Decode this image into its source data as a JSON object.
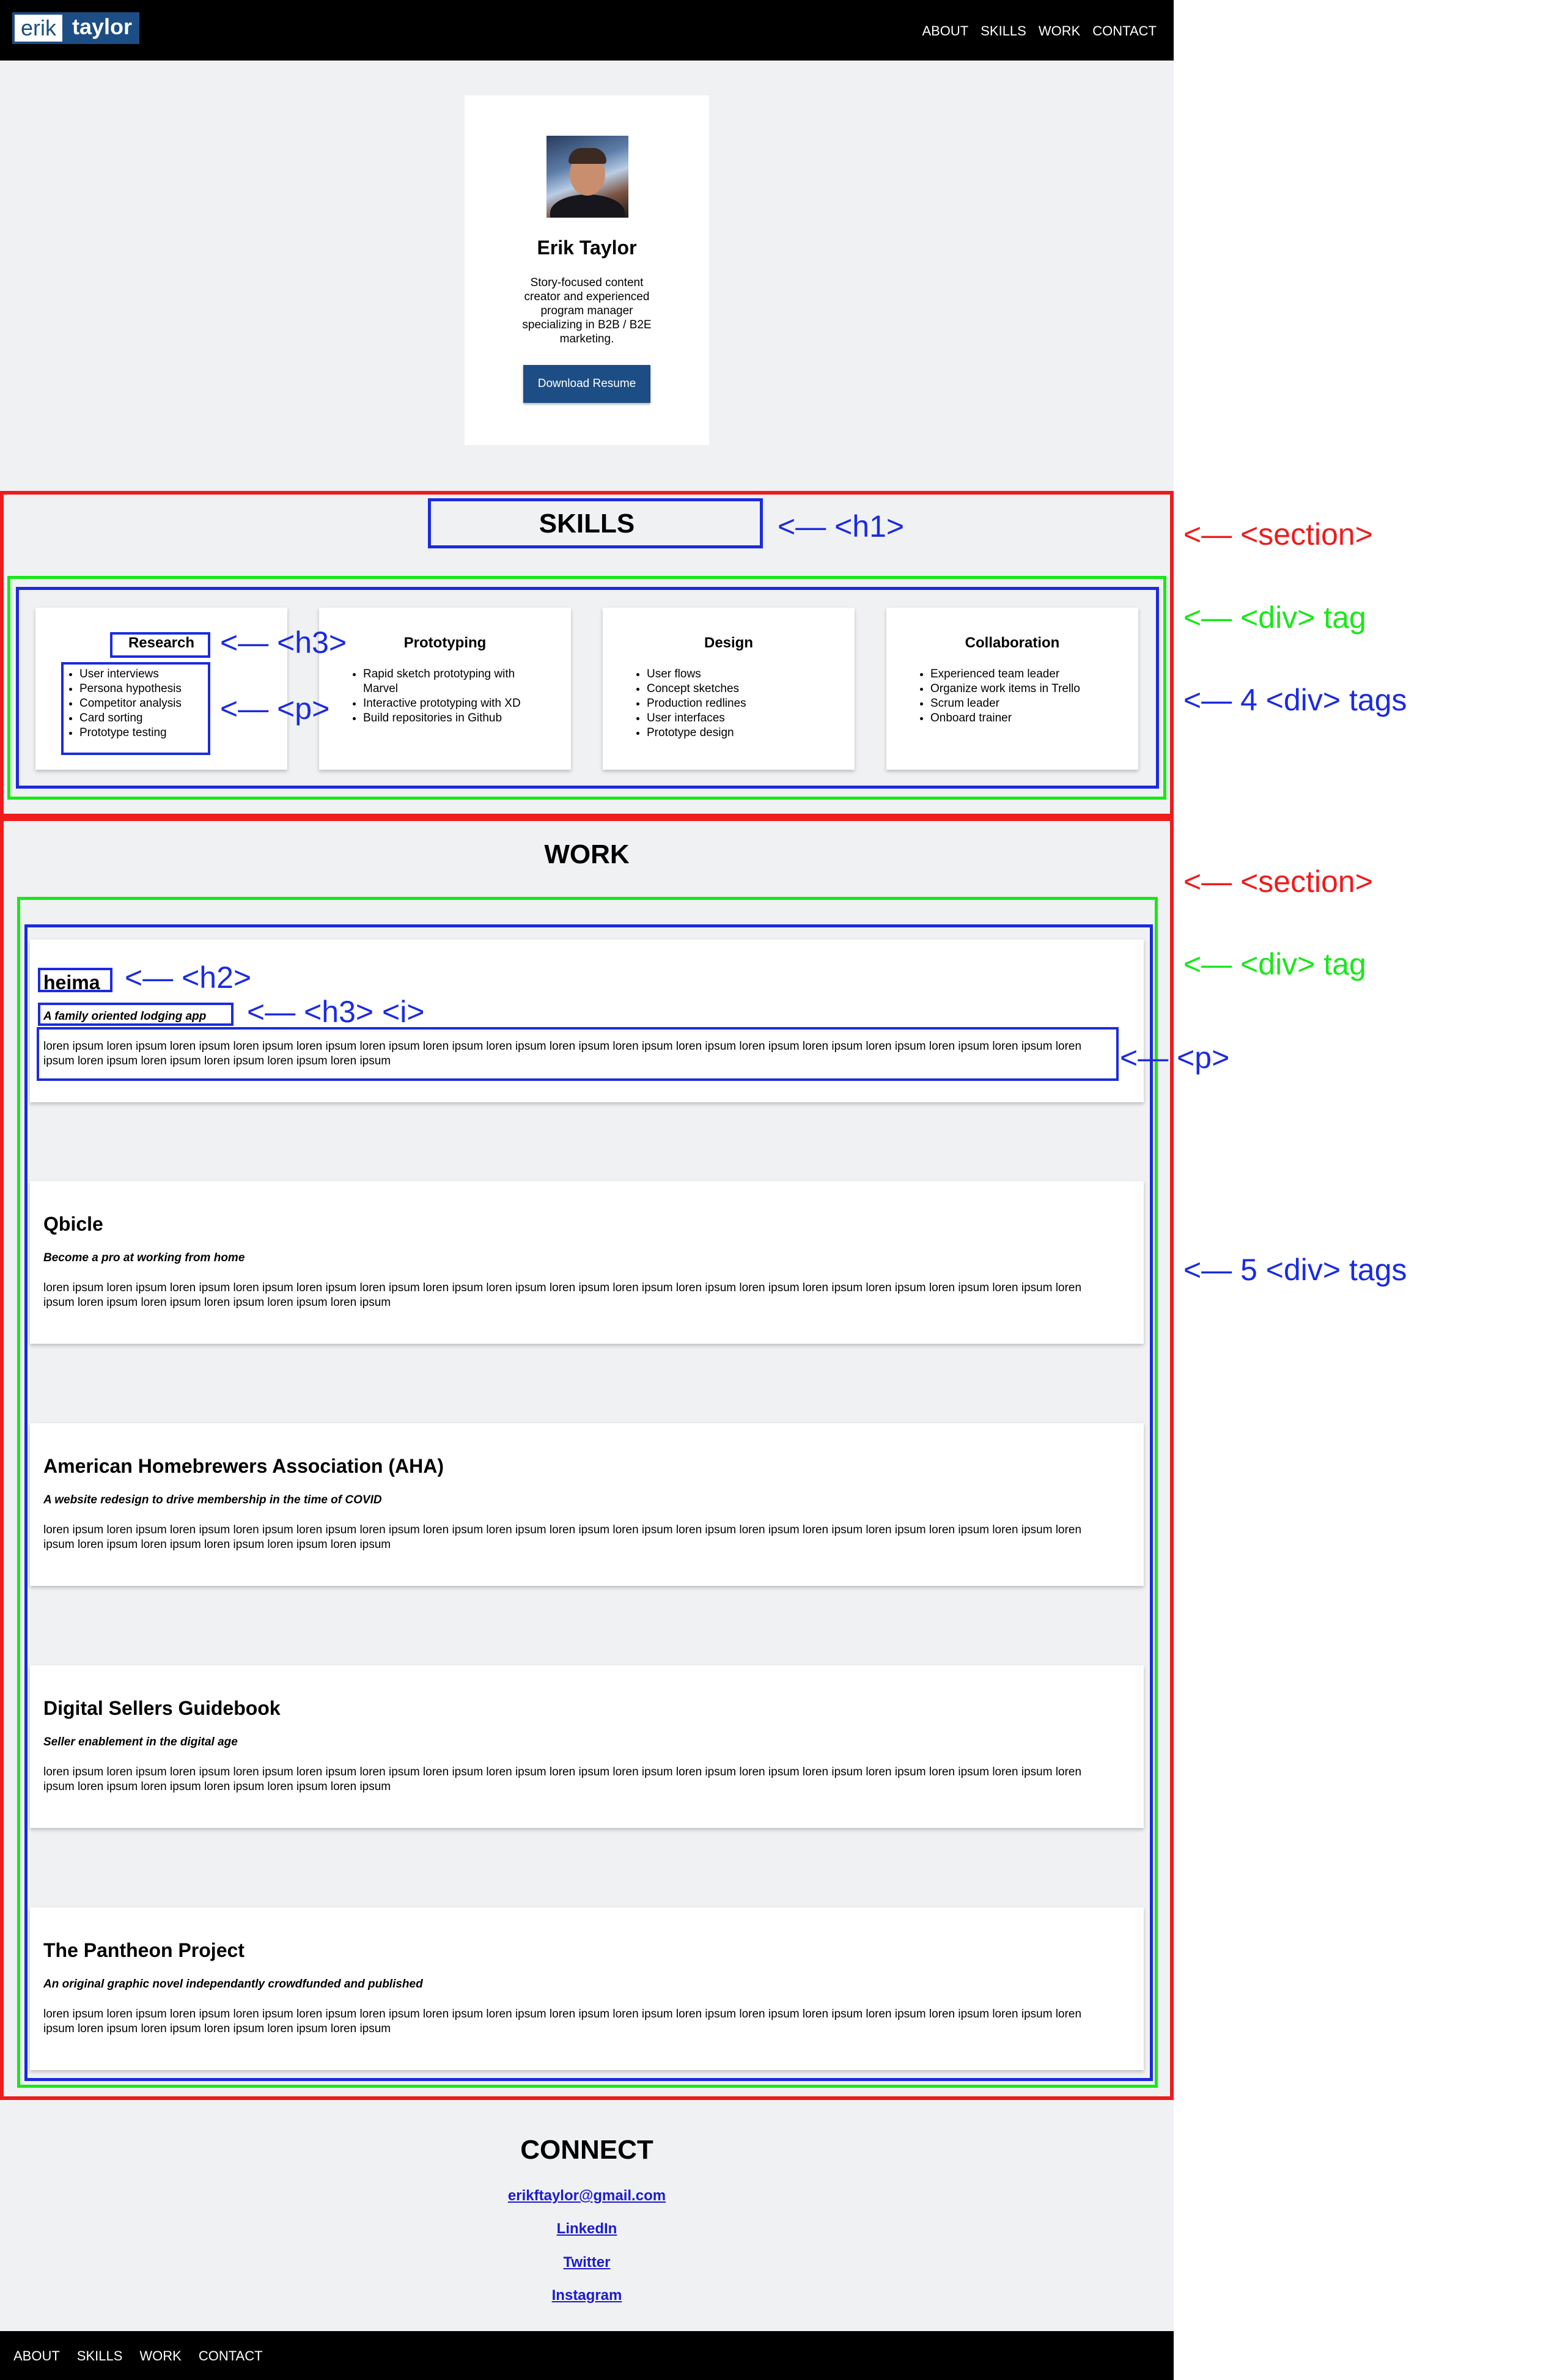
{
  "header": {
    "logo_first": "erik",
    "logo_last": "taylor",
    "nav": [
      "ABOUT",
      "SKILLS",
      "WORK",
      "CONTACT"
    ]
  },
  "profile": {
    "name": "Erik Taylor",
    "bio": "Story-focused content creator and experienced program manager specializing in B2B / B2E marketing.",
    "button": "Download Resume"
  },
  "skills": {
    "title": "SKILLS",
    "cards": [
      {
        "title": "Research",
        "items": [
          "User interviews",
          "Persona hypothesis",
          "Competitor analysis",
          "Card sorting",
          "Prototype testing"
        ]
      },
      {
        "title": "Prototyping",
        "items": [
          "Rapid sketch prototyping with Marvel",
          "Interactive prototyping with XD",
          "Build repositories in Github"
        ]
      },
      {
        "title": "Design",
        "items": [
          "User flows",
          "Concept sketches",
          "Production redlines",
          "User interfaces",
          "Prototype design"
        ]
      },
      {
        "title": "Collaboration",
        "items": [
          "Experienced team leader",
          "Organize work items in Trello",
          "Scrum leader",
          "Onboard trainer"
        ]
      }
    ]
  },
  "work": {
    "title": "WORK",
    "projects": [
      {
        "title": "heima",
        "subtitle": "A family oriented lodging app",
        "body": "loren ipsum loren ipsum loren ipsum loren ipsum loren ipsum loren ipsum loren ipsum loren ipsum loren ipsum loren ipsum loren ipsum loren ipsum loren ipsum loren ipsum loren ipsum loren ipsum loren ipsum loren ipsum loren ipsum loren ipsum loren ipsum loren ipsum"
      },
      {
        "title": "Qbicle",
        "subtitle": "Become a pro at working from home",
        "body": "loren ipsum loren ipsum loren ipsum loren ipsum loren ipsum loren ipsum loren ipsum loren ipsum loren ipsum loren ipsum loren ipsum loren ipsum loren ipsum loren ipsum loren ipsum loren ipsum loren ipsum loren ipsum loren ipsum loren ipsum loren ipsum loren ipsum"
      },
      {
        "title": "American Homebrewers Association (AHA)",
        "subtitle": "A website redesign to drive membership in the time of COVID",
        "body": "loren ipsum loren ipsum loren ipsum loren ipsum loren ipsum loren ipsum loren ipsum loren ipsum loren ipsum loren ipsum loren ipsum loren ipsum loren ipsum loren ipsum loren ipsum loren ipsum loren ipsum loren ipsum loren ipsum loren ipsum loren ipsum loren ipsum"
      },
      {
        "title": "Digital Sellers Guidebook",
        "subtitle": "Seller enablement in the digital age",
        "body": "loren ipsum loren ipsum loren ipsum loren ipsum loren ipsum loren ipsum loren ipsum loren ipsum loren ipsum loren ipsum loren ipsum loren ipsum loren ipsum loren ipsum loren ipsum loren ipsum loren ipsum loren ipsum loren ipsum loren ipsum loren ipsum loren ipsum"
      },
      {
        "title": "The Pantheon Project",
        "subtitle": "An original graphic novel independantly crowdfunded and published",
        "body": "loren ipsum loren ipsum loren ipsum loren ipsum loren ipsum loren ipsum loren ipsum loren ipsum loren ipsum loren ipsum loren ipsum loren ipsum loren ipsum loren ipsum loren ipsum loren ipsum loren ipsum loren ipsum loren ipsum loren ipsum loren ipsum loren ipsum"
      }
    ]
  },
  "connect": {
    "title": "CONNECT",
    "links": [
      "erikftaylor@gmail.com",
      "LinkedIn",
      "Twitter",
      "Instagram"
    ]
  },
  "footer": {
    "nav": [
      "ABOUT",
      "SKILLS",
      "WORK",
      "CONTACT"
    ]
  },
  "annotations": {
    "skills_h1": "<— <h1>",
    "skills_section": "<— <section>",
    "skills_div": "<— <div> tag",
    "skills_divs": "<— 4 <div> tags",
    "skills_h3": "<— <h3>",
    "skills_p": "<— <p>",
    "work_section": "<— <section>",
    "work_div": "<— <div> tag",
    "work_h2": "<— <h2>",
    "work_h3i": "<— <h3> <i>",
    "work_p": "<— <p>",
    "work_divs": "<— 5 <div> tags"
  },
  "colors": {
    "brand": "#1c4d84",
    "section_box": "#ee1c1c",
    "div_box": "#18e818",
    "element_box": "#1b2be0",
    "link": "#1b1bd0"
  }
}
